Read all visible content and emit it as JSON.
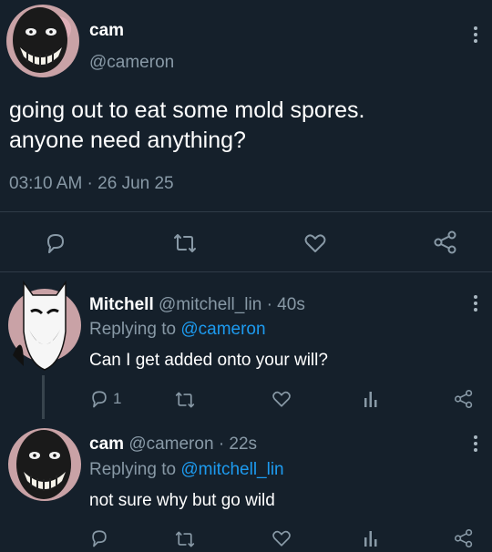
{
  "main_tweet": {
    "display_name": "cam",
    "handle": "@cameron",
    "text_line1": "going out to eat some mold spores.",
    "text_line2": "anyone need anything?",
    "timestamp": "03:10 AM · 26 Jun 25"
  },
  "reply1": {
    "display_name": "Mitchell",
    "handle": "@mitchell_lin",
    "time": "· 40s",
    "replying_prefix": "Replying to",
    "replying_to": "@cameron",
    "text": "Can I get added onto your will?",
    "reply_count": "1"
  },
  "reply2": {
    "display_name": "cam",
    "handle": "@cameron",
    "time": "· 22s",
    "replying_prefix": "Replying to",
    "replying_to": "@mitchell_lin",
    "text": "not sure why but go wild"
  },
  "colors": {
    "background": "#15202b",
    "muted": "#8899a6",
    "link": "#1d9bf0"
  },
  "icons": [
    "reply-icon",
    "retweet-icon",
    "like-icon",
    "share-icon",
    "analytics-icon",
    "more-icon"
  ]
}
